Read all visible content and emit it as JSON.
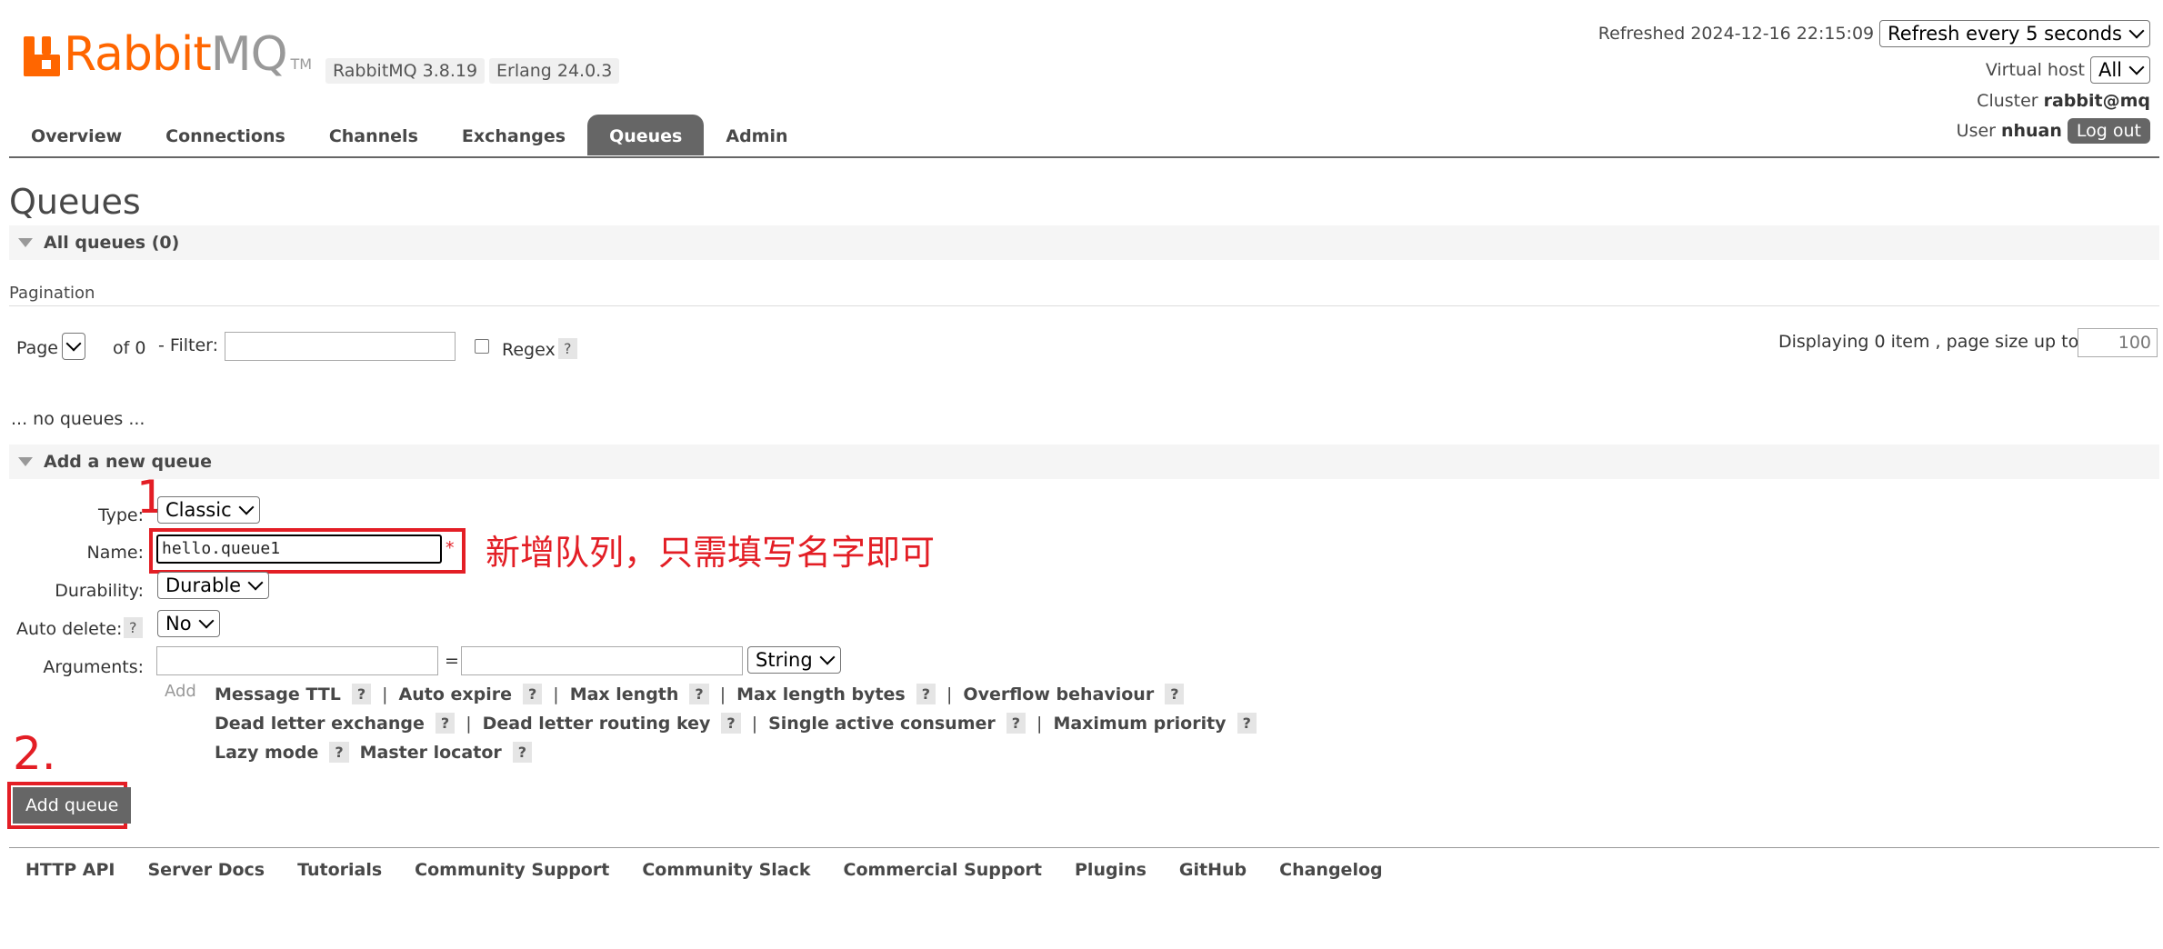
{
  "header": {
    "logo_word1": "Rabbit",
    "logo_word2": "MQ",
    "logo_tm": "TM",
    "version_rabbit": "RabbitMQ 3.8.19",
    "version_erlang": "Erlang 24.0.3",
    "refreshed_label": "Refreshed 2024-12-16 22:15:09",
    "refresh_select": "Refresh every 5 seconds",
    "vhost_label": "Virtual host",
    "vhost_value": "All",
    "cluster_label": "Cluster",
    "cluster_value": "rabbit@mq",
    "user_label": "User",
    "user_value": "nhuan",
    "logout_label": "Log out"
  },
  "tabs": [
    "Overview",
    "Connections",
    "Channels",
    "Exchanges",
    "Queues",
    "Admin"
  ],
  "active_tab": "Queues",
  "page_title": "Queues",
  "all_queues_label": "All queues (0)",
  "pagination": {
    "heading": "Pagination",
    "page_label": "Page",
    "of_label": "of 0",
    "filter_label": "- Filter:",
    "regex_label": "Regex",
    "help": "?",
    "displaying_label": "Displaying 0 item , page size up to:",
    "page_size": "100"
  },
  "no_queues_text": "... no queues ...",
  "add_queue_section": "Add a new queue",
  "form": {
    "type_label": "Type:",
    "type_value": "Classic",
    "name_label": "Name:",
    "name_value": "hello.queue1",
    "required_mark": "*",
    "durability_label": "Durability:",
    "durability_value": "Durable",
    "auto_delete_label": "Auto delete:",
    "auto_delete_help": "?",
    "auto_delete_value": "No",
    "arguments_label": "Arguments:",
    "equals": "=",
    "arg_type_value": "String",
    "add_label": "Add",
    "arg_row1": [
      "Message TTL",
      "Auto expire",
      "Max length",
      "Max length bytes",
      "Overflow behaviour"
    ],
    "arg_row2": [
      "Dead letter exchange",
      "Dead letter routing key",
      "Single active consumer",
      "Maximum priority"
    ],
    "arg_row3": [
      "Lazy mode",
      "Master locator"
    ],
    "help": "?",
    "separator": "|"
  },
  "add_queue_button": "Add queue",
  "annotations": {
    "step1": "1.",
    "step2": "2.",
    "note": "新增队列，只需填写名字即可",
    "color": "#e31e25"
  },
  "footer": [
    "HTTP API",
    "Server Docs",
    "Tutorials",
    "Community Support",
    "Community Slack",
    "Commercial Support",
    "Plugins",
    "GitHub",
    "Changelog"
  ]
}
